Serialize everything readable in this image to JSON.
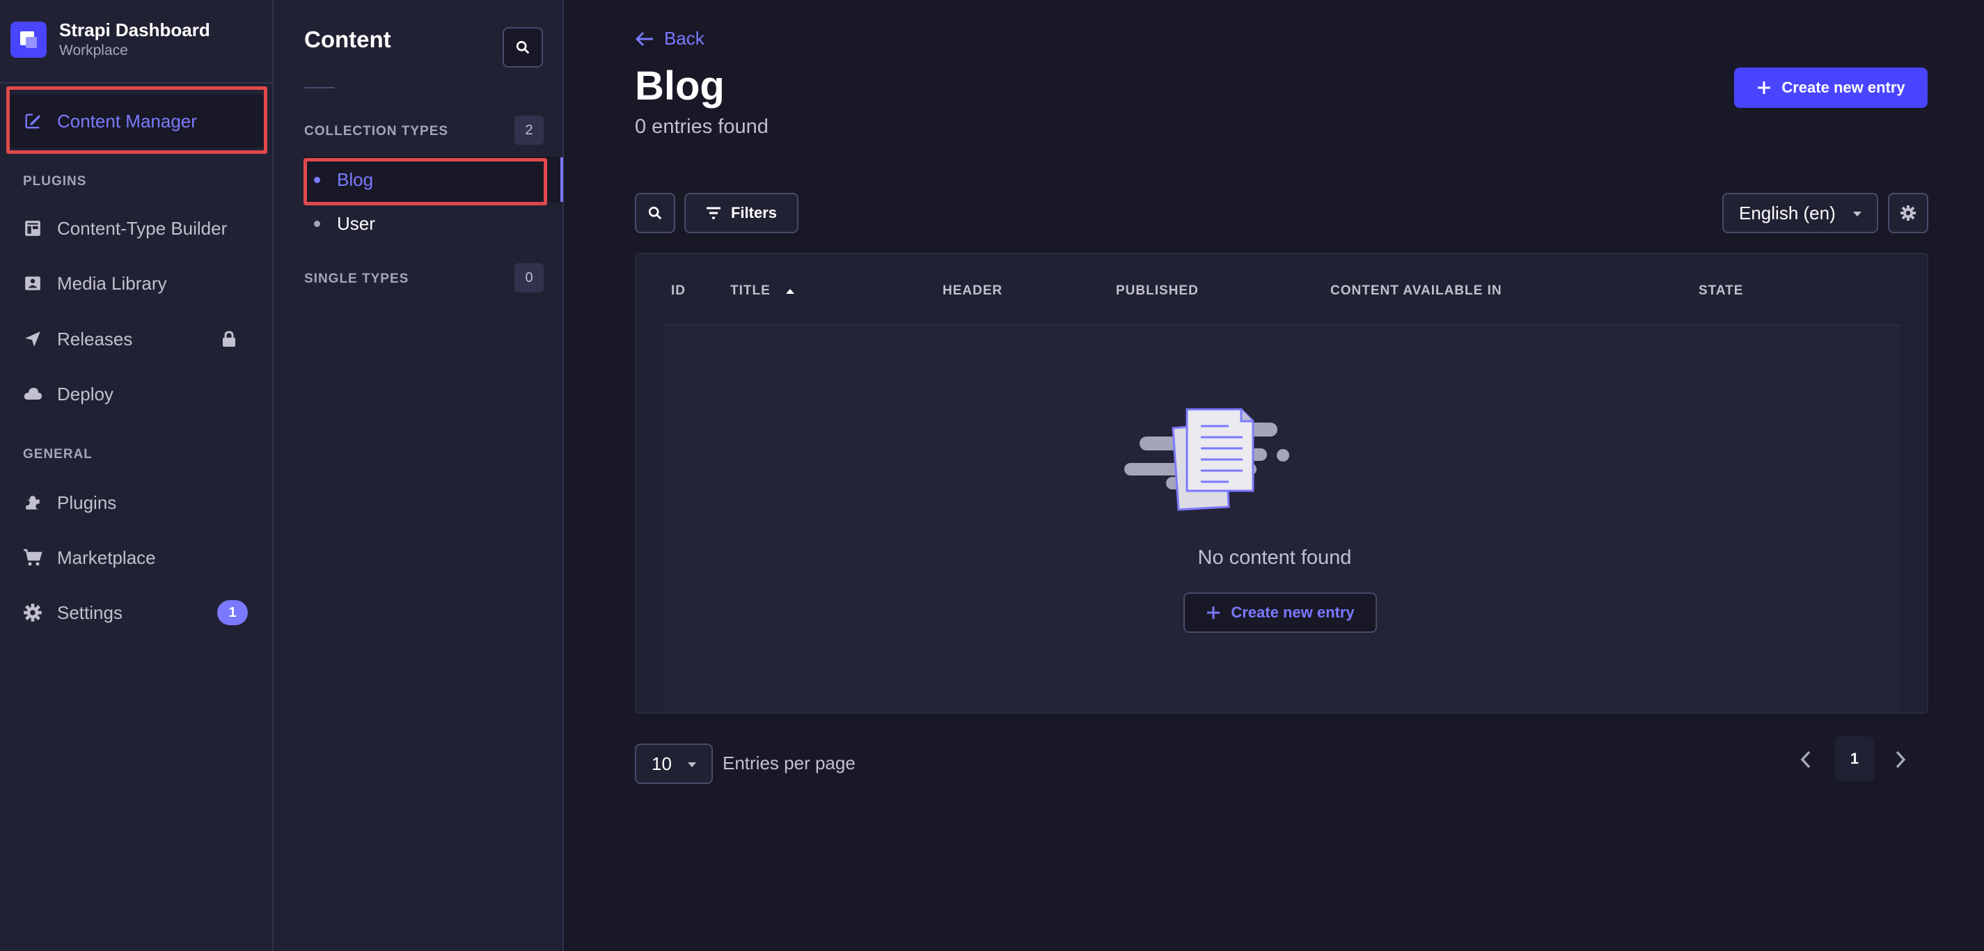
{
  "brand": {
    "title": "Strapi Dashboard",
    "subtitle": "Workplace"
  },
  "left_nav": {
    "items": [
      {
        "label": "Content Manager",
        "icon": "feather-icon",
        "active": true
      },
      {
        "label": "Content-Type Builder",
        "icon": "layout-icon"
      },
      {
        "label": "Media Library",
        "icon": "image-icon"
      },
      {
        "label": "Releases",
        "icon": "paper-plane-icon",
        "locked": true
      },
      {
        "label": "Deploy",
        "icon": "cloud-icon"
      },
      {
        "label": "Plugins",
        "icon": "puzzle-icon"
      },
      {
        "label": "Marketplace",
        "icon": "shopping-cart-icon"
      },
      {
        "label": "Settings",
        "icon": "gear-icon",
        "badge": "1"
      }
    ],
    "sections": {
      "plugins": "PLUGINS",
      "general": "GENERAL"
    }
  },
  "sub_nav": {
    "title": "Content",
    "collection_types": {
      "label": "COLLECTION TYPES",
      "count": "2",
      "items": [
        "Blog",
        "User"
      ]
    },
    "single_types": {
      "label": "SINGLE TYPES",
      "count": "0"
    }
  },
  "main": {
    "back_label": "Back",
    "title": "Blog",
    "subtitle": "0 entries found",
    "create_button": "Create new entry",
    "filters_label": "Filters",
    "locale": "English (en)",
    "table": {
      "columns": [
        "ID",
        "TITLE",
        "HEADER",
        "PUBLISHED",
        "CONTENT AVAILABLE IN",
        "STATE"
      ],
      "sorted_column": "TITLE",
      "sort_direction": "ascending"
    },
    "empty_state": {
      "message": "No content found",
      "button": "Create new entry"
    },
    "pagination": {
      "per_page": "10",
      "per_page_label": "Entries per page",
      "current_page": "1"
    }
  },
  "colors": {
    "accent": "#7b79ff",
    "primary": "#4945ff",
    "highlight": "#e0494c",
    "background": "#181826",
    "panel": "#212134"
  }
}
